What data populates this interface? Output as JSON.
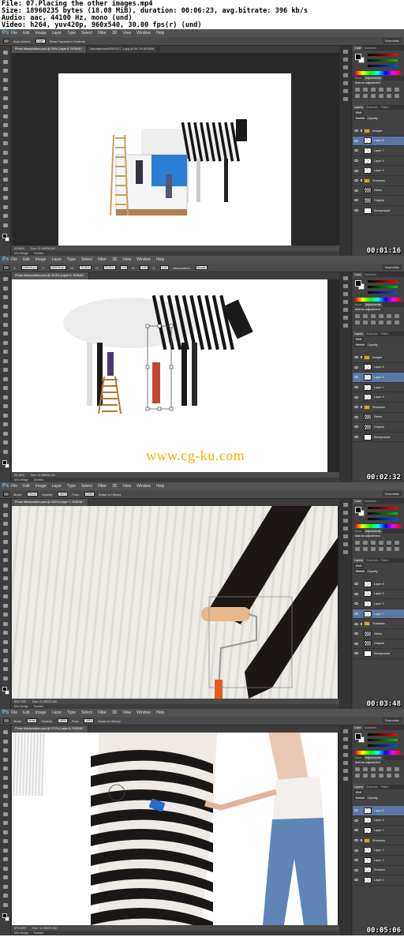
{
  "file_info": {
    "line1": "File: 07.Placing the other images.mp4",
    "line2": "Size: 18960235 bytes (18.08 MiB), duration: 00:06:23, avg.bitrate: 396 kb/s",
    "line3": "Audio: aac, 44100 Hz, mono (und)",
    "line4": "Video: h264, yuv420p, 960x540, 30.00 fps(r) (und)"
  },
  "menu": [
    "File",
    "Edit",
    "Image",
    "Layer",
    "Type",
    "Select",
    "Filter",
    "3D",
    "View",
    "Window",
    "Help"
  ],
  "app_logo": "Ps",
  "workspace": "Essentials",
  "panel_tabs": {
    "color": "Color",
    "swatches": "Swatches",
    "styles": "Styles",
    "adjustments": "Adjustments",
    "add_adjustment": "Add an adjustment",
    "layers": "Layers",
    "channels": "Channels",
    "paths": "Paths",
    "kind": "Kind",
    "normal": "Normal",
    "opacity": "Opacity"
  },
  "bottom_tabs": [
    "Mini Bridge",
    "Timeline"
  ],
  "frames": [
    {
      "timecode": "00:01:16",
      "options": [
        "Auto-Select:",
        "Layer",
        "Show Transform Controls"
      ],
      "tabs": [
        "Photo Manipulation.psd @ 30% (Layer 8, RGB/8) *",
        "DepositphotosSRV0117_s.jpg @ 66.7% (RGB/8)"
      ],
      "zoom": "29.98%",
      "doc": "Doc: 11.0M/39.2M",
      "layers": [
        {
          "name": "Images",
          "kind": "folder",
          "selected": false
        },
        {
          "name": "Layer 8",
          "kind": "layer",
          "selected": true
        },
        {
          "name": "Layer 7",
          "kind": "layer",
          "selected": false
        },
        {
          "name": "Layer 6",
          "kind": "layer",
          "selected": false
        },
        {
          "name": "Layer 5",
          "kind": "layer",
          "selected": false
        },
        {
          "name": "Shadows",
          "kind": "folder",
          "selected": false
        },
        {
          "name": "Zebra",
          "kind": "zebra",
          "selected": false
        },
        {
          "name": "Original",
          "kind": "zebra",
          "selected": false
        },
        {
          "name": "Background",
          "kind": "white",
          "selected": false
        }
      ]
    },
    {
      "timecode": "00:02:32",
      "options": [
        "X:",
        "1596.00 px",
        "Y:",
        "1561.50 px",
        "W:",
        "75.91%",
        "H:",
        "75.91%",
        "0.00",
        "H:",
        "0.00",
        "V:",
        "0.00",
        "Interpolation:",
        "Bicubic"
      ],
      "tabs": [
        "Photo Manipulation.psd @ 45.5% (Layer 6, RGB/8) *"
      ],
      "zoom": "45.45%",
      "doc": "Doc: 11.0M/26.2M",
      "watermark": "www.cg-ku.com",
      "layers": [
        {
          "name": "Images",
          "kind": "folder",
          "selected": false
        },
        {
          "name": "Layer 8",
          "kind": "layer",
          "selected": false
        },
        {
          "name": "Layer 6",
          "kind": "layer",
          "selected": true
        },
        {
          "name": "Layer 7",
          "kind": "layer",
          "selected": false
        },
        {
          "name": "Layer 5",
          "kind": "layer",
          "selected": false
        },
        {
          "name": "Shadows",
          "kind": "folder",
          "selected": false
        },
        {
          "name": "Zebra",
          "kind": "zebra",
          "selected": false
        },
        {
          "name": "Original",
          "kind": "zebra",
          "selected": false
        },
        {
          "name": "Background",
          "kind": "white",
          "selected": false
        }
      ]
    },
    {
      "timecode": "00:03:48",
      "options": [
        "Mode:",
        "Pencil",
        "Opacity:",
        "100%",
        "Flow:",
        "100%",
        "Erase to History"
      ],
      "tabs": [
        "Photo Manipulation.psd @ 530% (Layer 7, RGB/8) *"
      ],
      "zoom": "529.73%",
      "doc": "Doc: 11.0M/23.6M",
      "layers": [
        {
          "name": "Layer 8",
          "kind": "layer",
          "selected": false
        },
        {
          "name": "Layer 6",
          "kind": "layer",
          "selected": false
        },
        {
          "name": "Layer 5",
          "kind": "layer",
          "selected": false
        },
        {
          "name": "Layer 7",
          "kind": "layer",
          "selected": true
        },
        {
          "name": "Shadows",
          "kind": "folder",
          "selected": false
        },
        {
          "name": "Zebra",
          "kind": "zebra",
          "selected": false
        },
        {
          "name": "Original",
          "kind": "zebra",
          "selected": false
        },
        {
          "name": "Background",
          "kind": "white",
          "selected": false
        }
      ]
    },
    {
      "timecode": "00:05:06",
      "options": [
        "Mode:",
        "Brush",
        "Opacity:",
        "100%",
        "Flow:",
        "100%",
        "Erase to History"
      ],
      "tabs": [
        "Photo Manipulation.psd @ 371% (Layer 8, RGB/8) *"
      ],
      "zoom": "370.99%",
      "doc": "Doc: 11.0M/23.6M",
      "layers": [
        {
          "name": "Layer 8",
          "kind": "layer",
          "selected": true
        },
        {
          "name": "Layer 6",
          "kind": "layer",
          "selected": false
        },
        {
          "name": "Layer 7",
          "kind": "layer",
          "selected": false
        },
        {
          "name": "Shadows",
          "kind": "folder",
          "selected": false
        },
        {
          "name": "Layer 2",
          "kind": "layer",
          "selected": false
        },
        {
          "name": "Layer 3",
          "kind": "layer",
          "selected": false
        },
        {
          "name": "Shadow",
          "kind": "layer",
          "selected": false
        },
        {
          "name": "Layer 4",
          "kind": "layer",
          "selected": false
        }
      ]
    }
  ]
}
